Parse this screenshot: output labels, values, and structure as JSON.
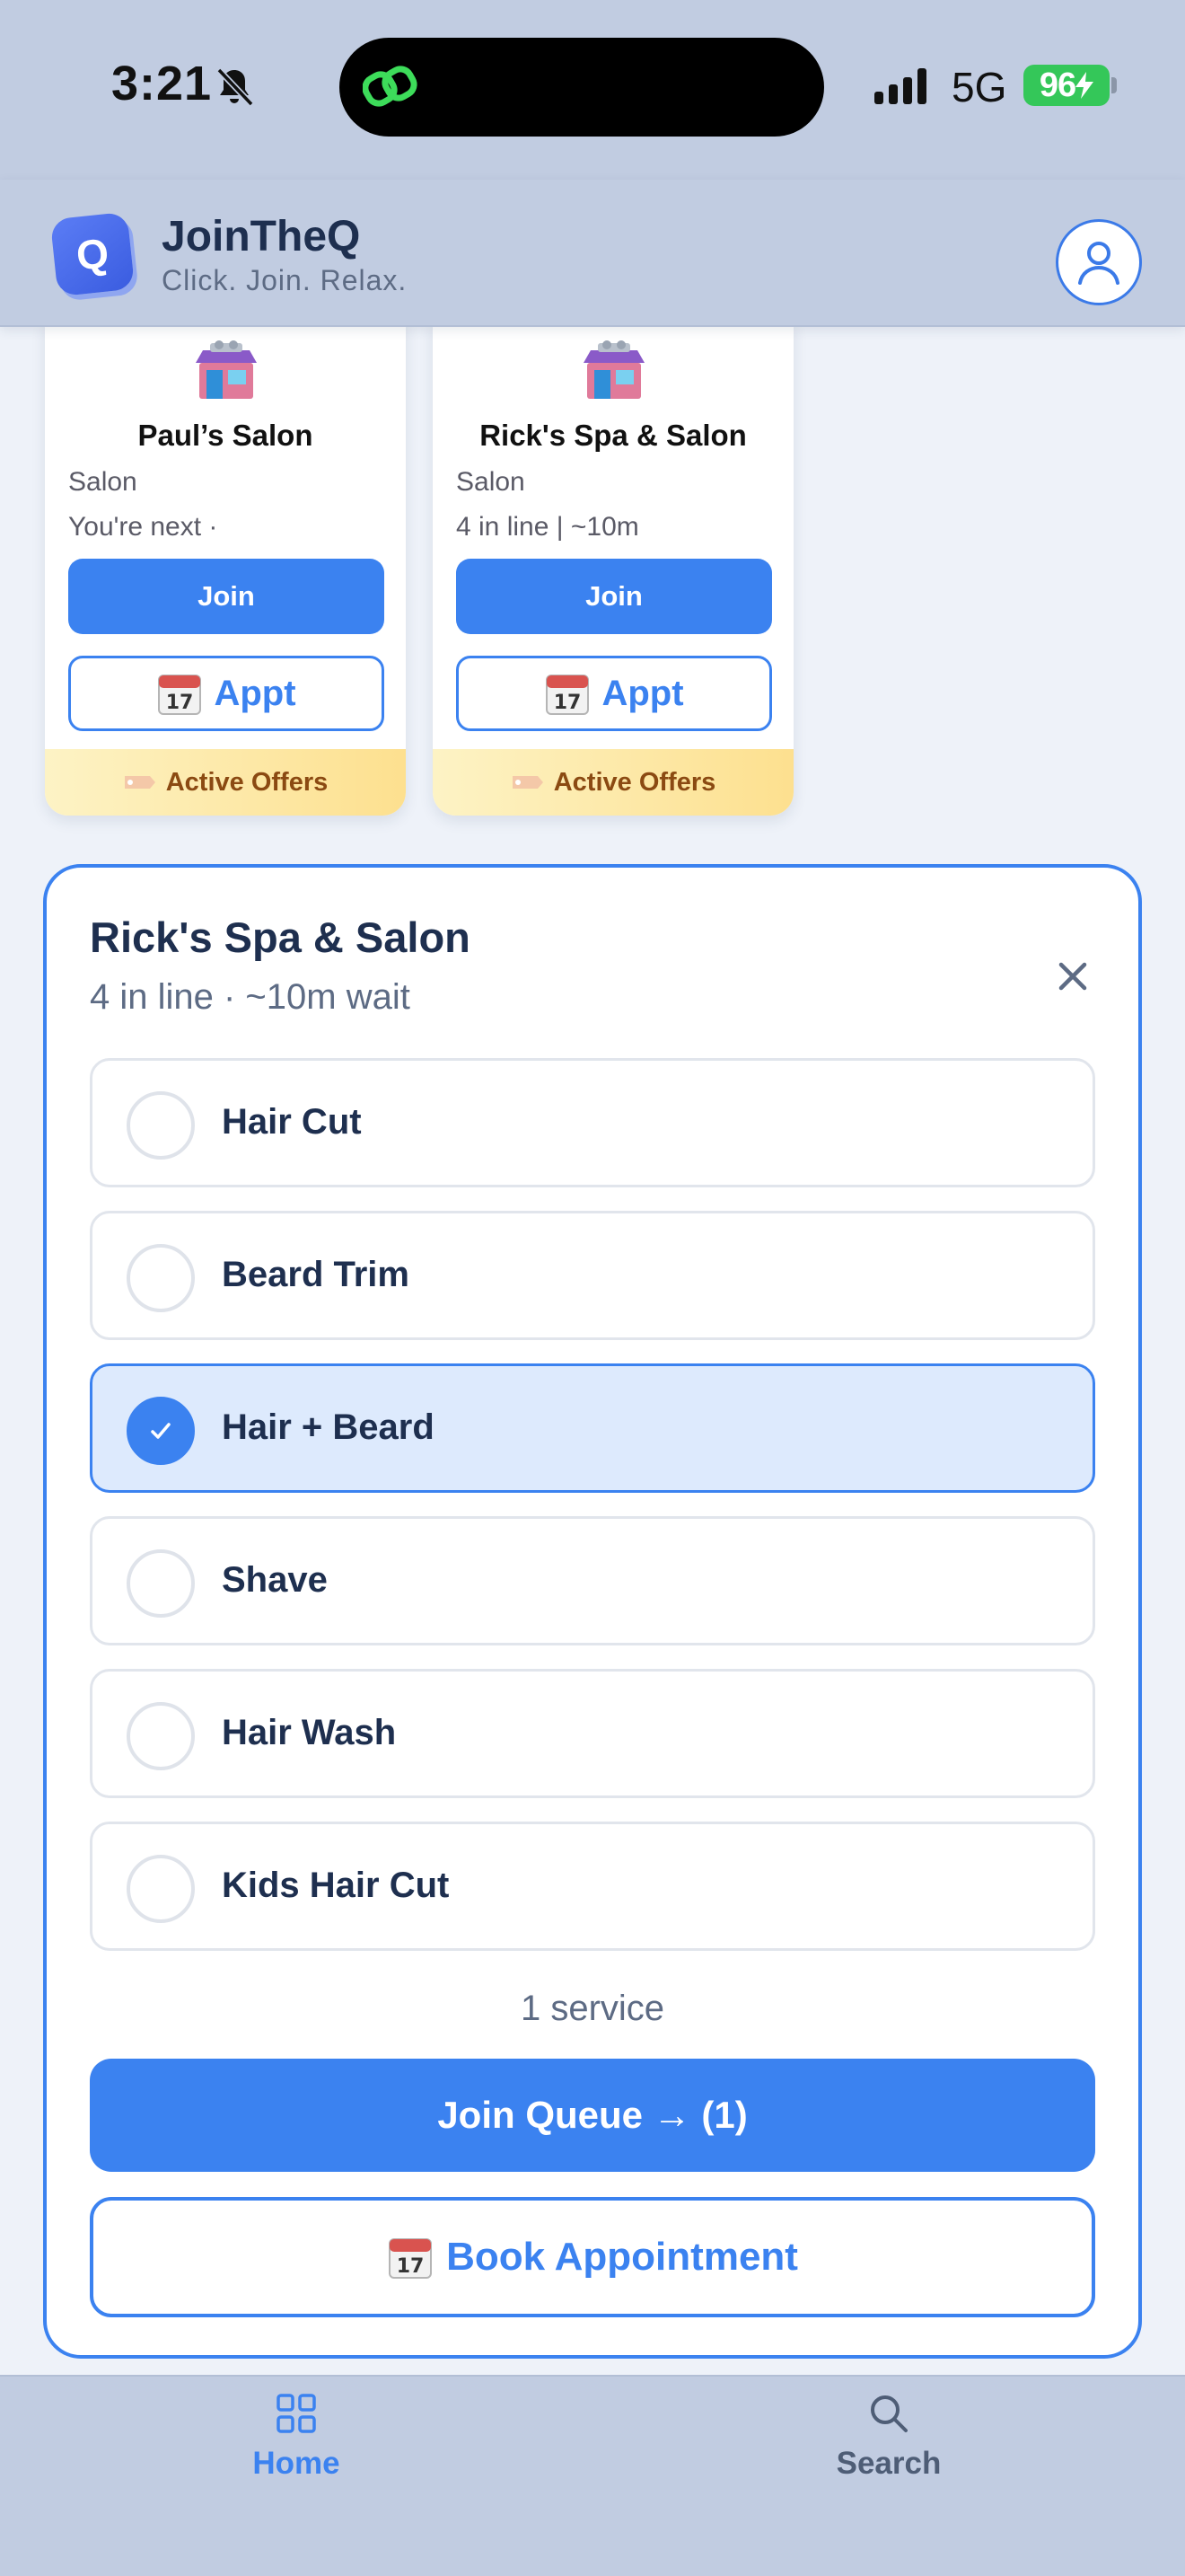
{
  "status_bar": {
    "time": "3:21",
    "network": "5G",
    "battery": "96"
  },
  "header": {
    "title": "JoinTheQ",
    "tagline": "Click. Join. Relax.",
    "logo_letter": "Q"
  },
  "salon_cards": [
    {
      "name": "Paul’s Salon",
      "type": "Salon",
      "status": "You're next ·",
      "join_label": "Join",
      "appt_label": "Appt",
      "offers_label": "Active Offers"
    },
    {
      "name": "Rick's Spa & Salon",
      "type": "Salon",
      "status": "4 in line | ~10m",
      "join_label": "Join",
      "appt_label": "Appt",
      "offers_label": "Active Offers"
    }
  ],
  "service_panel": {
    "title": "Rick's Spa & Salon",
    "subtitle": "4 in line · ~10m wait",
    "services": [
      {
        "label": "Hair Cut",
        "selected": false
      },
      {
        "label": "Beard Trim",
        "selected": false
      },
      {
        "label": "Hair + Beard",
        "selected": true
      },
      {
        "label": "Shave",
        "selected": false
      },
      {
        "label": "Hair Wash",
        "selected": false
      },
      {
        "label": "Kids Hair Cut",
        "selected": false
      }
    ],
    "count_text": "1 service",
    "join_queue_label": "Join Queue → (1)",
    "book_label": "Book Appointment"
  },
  "tab_bar": {
    "home_label": "Home",
    "search_label": "Search",
    "active_tab": "home"
  },
  "colors": {
    "accent": "#3b82f0",
    "header_bg": "#c1cce1",
    "selected_bg": "#ddeafd",
    "offers_text": "#8b4a12",
    "battery": "#34c759"
  },
  "icons": {
    "bell": "bell-slash-icon",
    "profile": "user-icon",
    "store": "storefront-icon",
    "calendar": "calendar-icon",
    "tag": "tag-icon",
    "close": "close-icon",
    "check": "check-icon",
    "home": "grid-icon",
    "search": "search-icon"
  }
}
